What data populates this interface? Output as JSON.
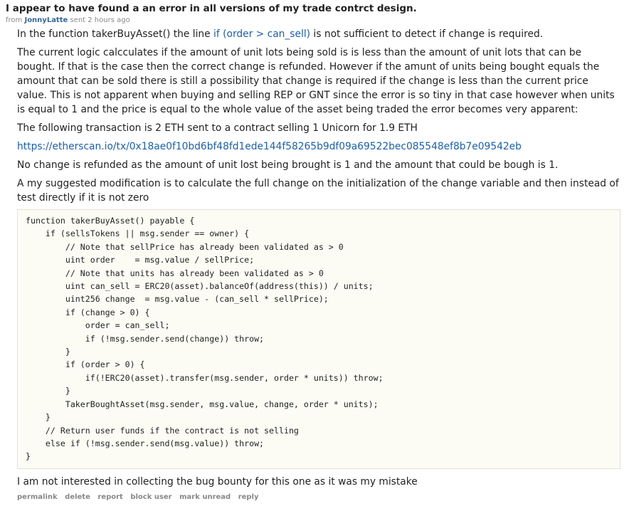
{
  "message": {
    "subject": "I appear to have found a an error in all versions of my trade contrct design.",
    "from_label": "from",
    "author": "JonnyLatte",
    "sent": "sent 2 hours ago",
    "body": {
      "p1_before": "In the function takerBuyAsset() the line ",
      "p1_link": "if (order > can_sell)",
      "p1_after": " is not sufficient to detect if change is required.",
      "p2": "The current logic calcculates if the amount of unit lots being sold is is less than the amount of unit lots that can be bought. If that is the case then the correct change is refunded. However if the amunt of units being bought equals the amount that can be sold there is still a possibility that change is required if the change is less than the current price value. This is not apparent when buying and selling REP or GNT since the error is so tiny in that case however when units is equal to 1 and the price is equal to the whole value of the asset being traded the error becomes very apparent:",
      "p3": "The following transaction is 2 ETH sent to a contract selling 1 Unicorn for 1.9 ETH",
      "p4_link": "https://etherscan.io/tx/0x18ae0f10bd6bf48fd1ede144f58265b9df09a69522bec085548ef8b7e09542eb",
      "p5": "No change is refunded as the amount of unit lost being brought is 1 and the amount that could be bough is 1.",
      "p6": "A my suggested modification is to calculate the full change on the initialization of the change variable and then instead of test directly if it is not zero",
      "code": "function takerBuyAsset() payable {\n    if (sellsTokens || msg.sender == owner) {\n        // Note that sellPrice has already been validated as > 0\n        uint order    = msg.value / sellPrice;\n        // Note that units has already been validated as > 0\n        uint can_sell = ERC20(asset).balanceOf(address(this)) / units;\n        uint256 change  = msg.value - (can_sell * sellPrice);\n        if (change > 0) {\n            order = can_sell;\n            if (!msg.sender.send(change)) throw;\n        }\n        if (order > 0) {\n            if(!ERC20(asset).transfer(msg.sender, order * units)) throw;\n        }\n        TakerBoughtAsset(msg.sender, msg.value, change, order * units);\n    }\n    // Return user funds if the contract is not selling\n    else if (!msg.sender.send(msg.value)) throw;\n}",
      "p7": "I am not interested in collecting the bug bounty for this one as it was my mistake"
    },
    "buttons": {
      "permalink": "permalink",
      "delete": "delete",
      "report": "report",
      "block_user": "block user",
      "mark_unread": "mark unread",
      "reply": "reply"
    }
  },
  "colors": {
    "link": "#1a5fb4",
    "author": "#336699",
    "muted": "#888888",
    "code_bg": "#fcfcf5",
    "code_border": "#e2e2d2"
  }
}
